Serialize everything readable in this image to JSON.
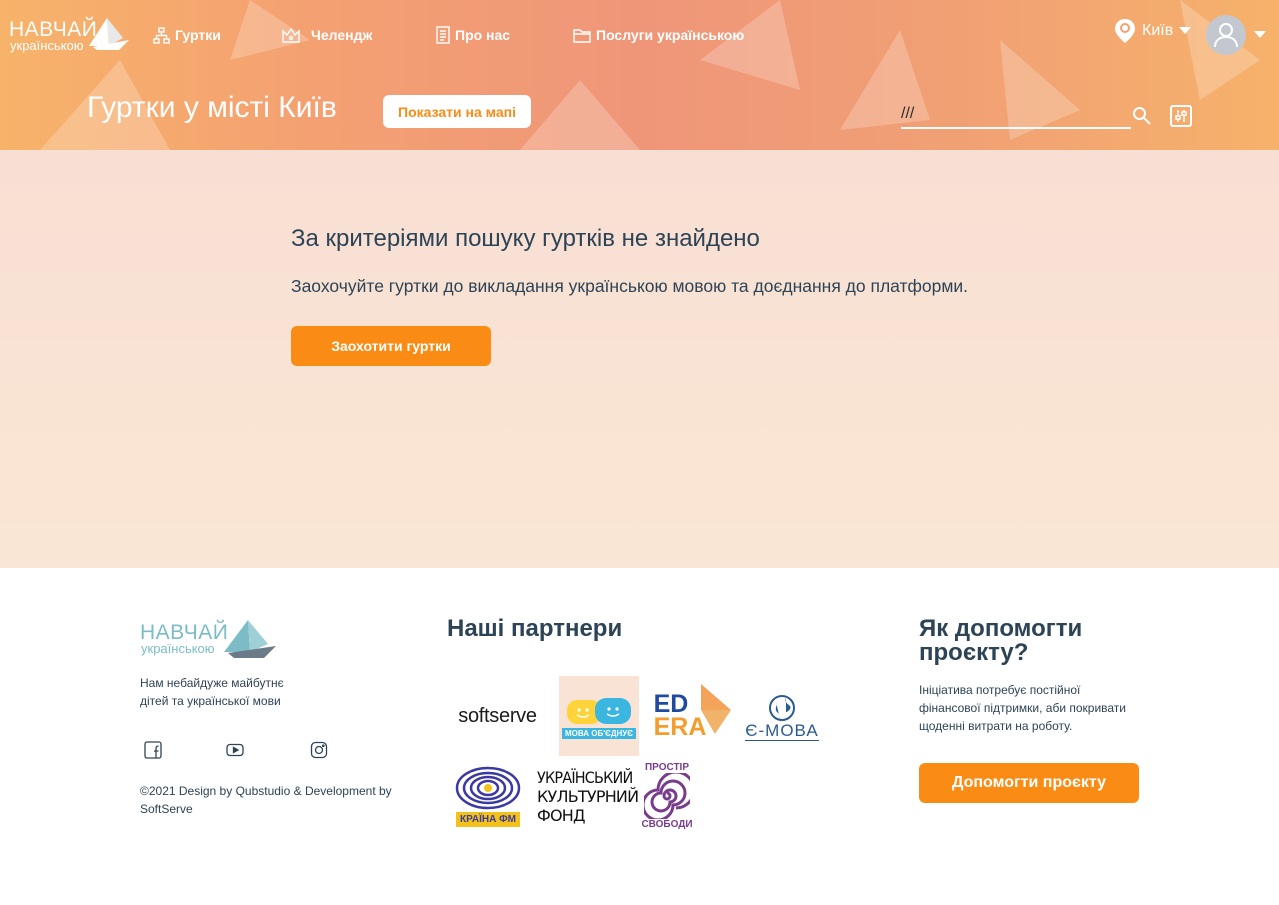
{
  "header": {
    "logo_title": "НАВЧАЙ",
    "logo_subtitle": "українською",
    "nav": [
      {
        "label": "Гуртки",
        "icon": "cluster-icon"
      },
      {
        "label": "Челендж",
        "icon": "crown-icon"
      },
      {
        "label": "Про нас",
        "icon": "document-icon"
      },
      {
        "label": "Послуги українською",
        "icon": "folder-icon"
      }
    ],
    "city": "Київ",
    "page_title": "Гуртки у місті Київ",
    "map_button": "Показати на мапі",
    "search_value": "///"
  },
  "main": {
    "empty_title": "За критеріями пошуку гуртків не знайдено",
    "empty_text": "Заохочуйте гуртки до викладання українською мовою та доєднання до платформи.",
    "encourage_button": "Заохотити гуртки"
  },
  "footer": {
    "logo_title": "НАВЧАЙ",
    "logo_subtitle": "українською",
    "description": "Нам небайдуже майбутнє дітей та української мови",
    "copyright": "©2021 Design by Qubstudio & Development by SoftServe",
    "partners_title": "Наші партнери",
    "partners": {
      "softserve": "softserve",
      "mova_obiednuie": "МОВА ОБ'ЄДНУЄ",
      "edera_1": "ED",
      "edera_2": "ERA",
      "emova": "Є-МОВА",
      "kraina_fm": "КРАЇНА ФМ",
      "ukf_1": "УКРАЇНСЬКИЙ",
      "ukf_2": "КУЛЬТУРНИЙ",
      "ukf_3": "ФОНД",
      "prostir_1": "ПРОСТІР",
      "prostir_2": "СВОБОДИ"
    },
    "help_title": "Як допомогти проєкту?",
    "help_text": "Ініціатива потребує постійної фінансової підтримки, аби покривати щоденні витрати на роботу.",
    "help_button": "Допомогти проєкту"
  },
  "colors": {
    "accent": "#fa8c16",
    "text": "#2d4356",
    "logo_teal": "#7bbcc7"
  }
}
